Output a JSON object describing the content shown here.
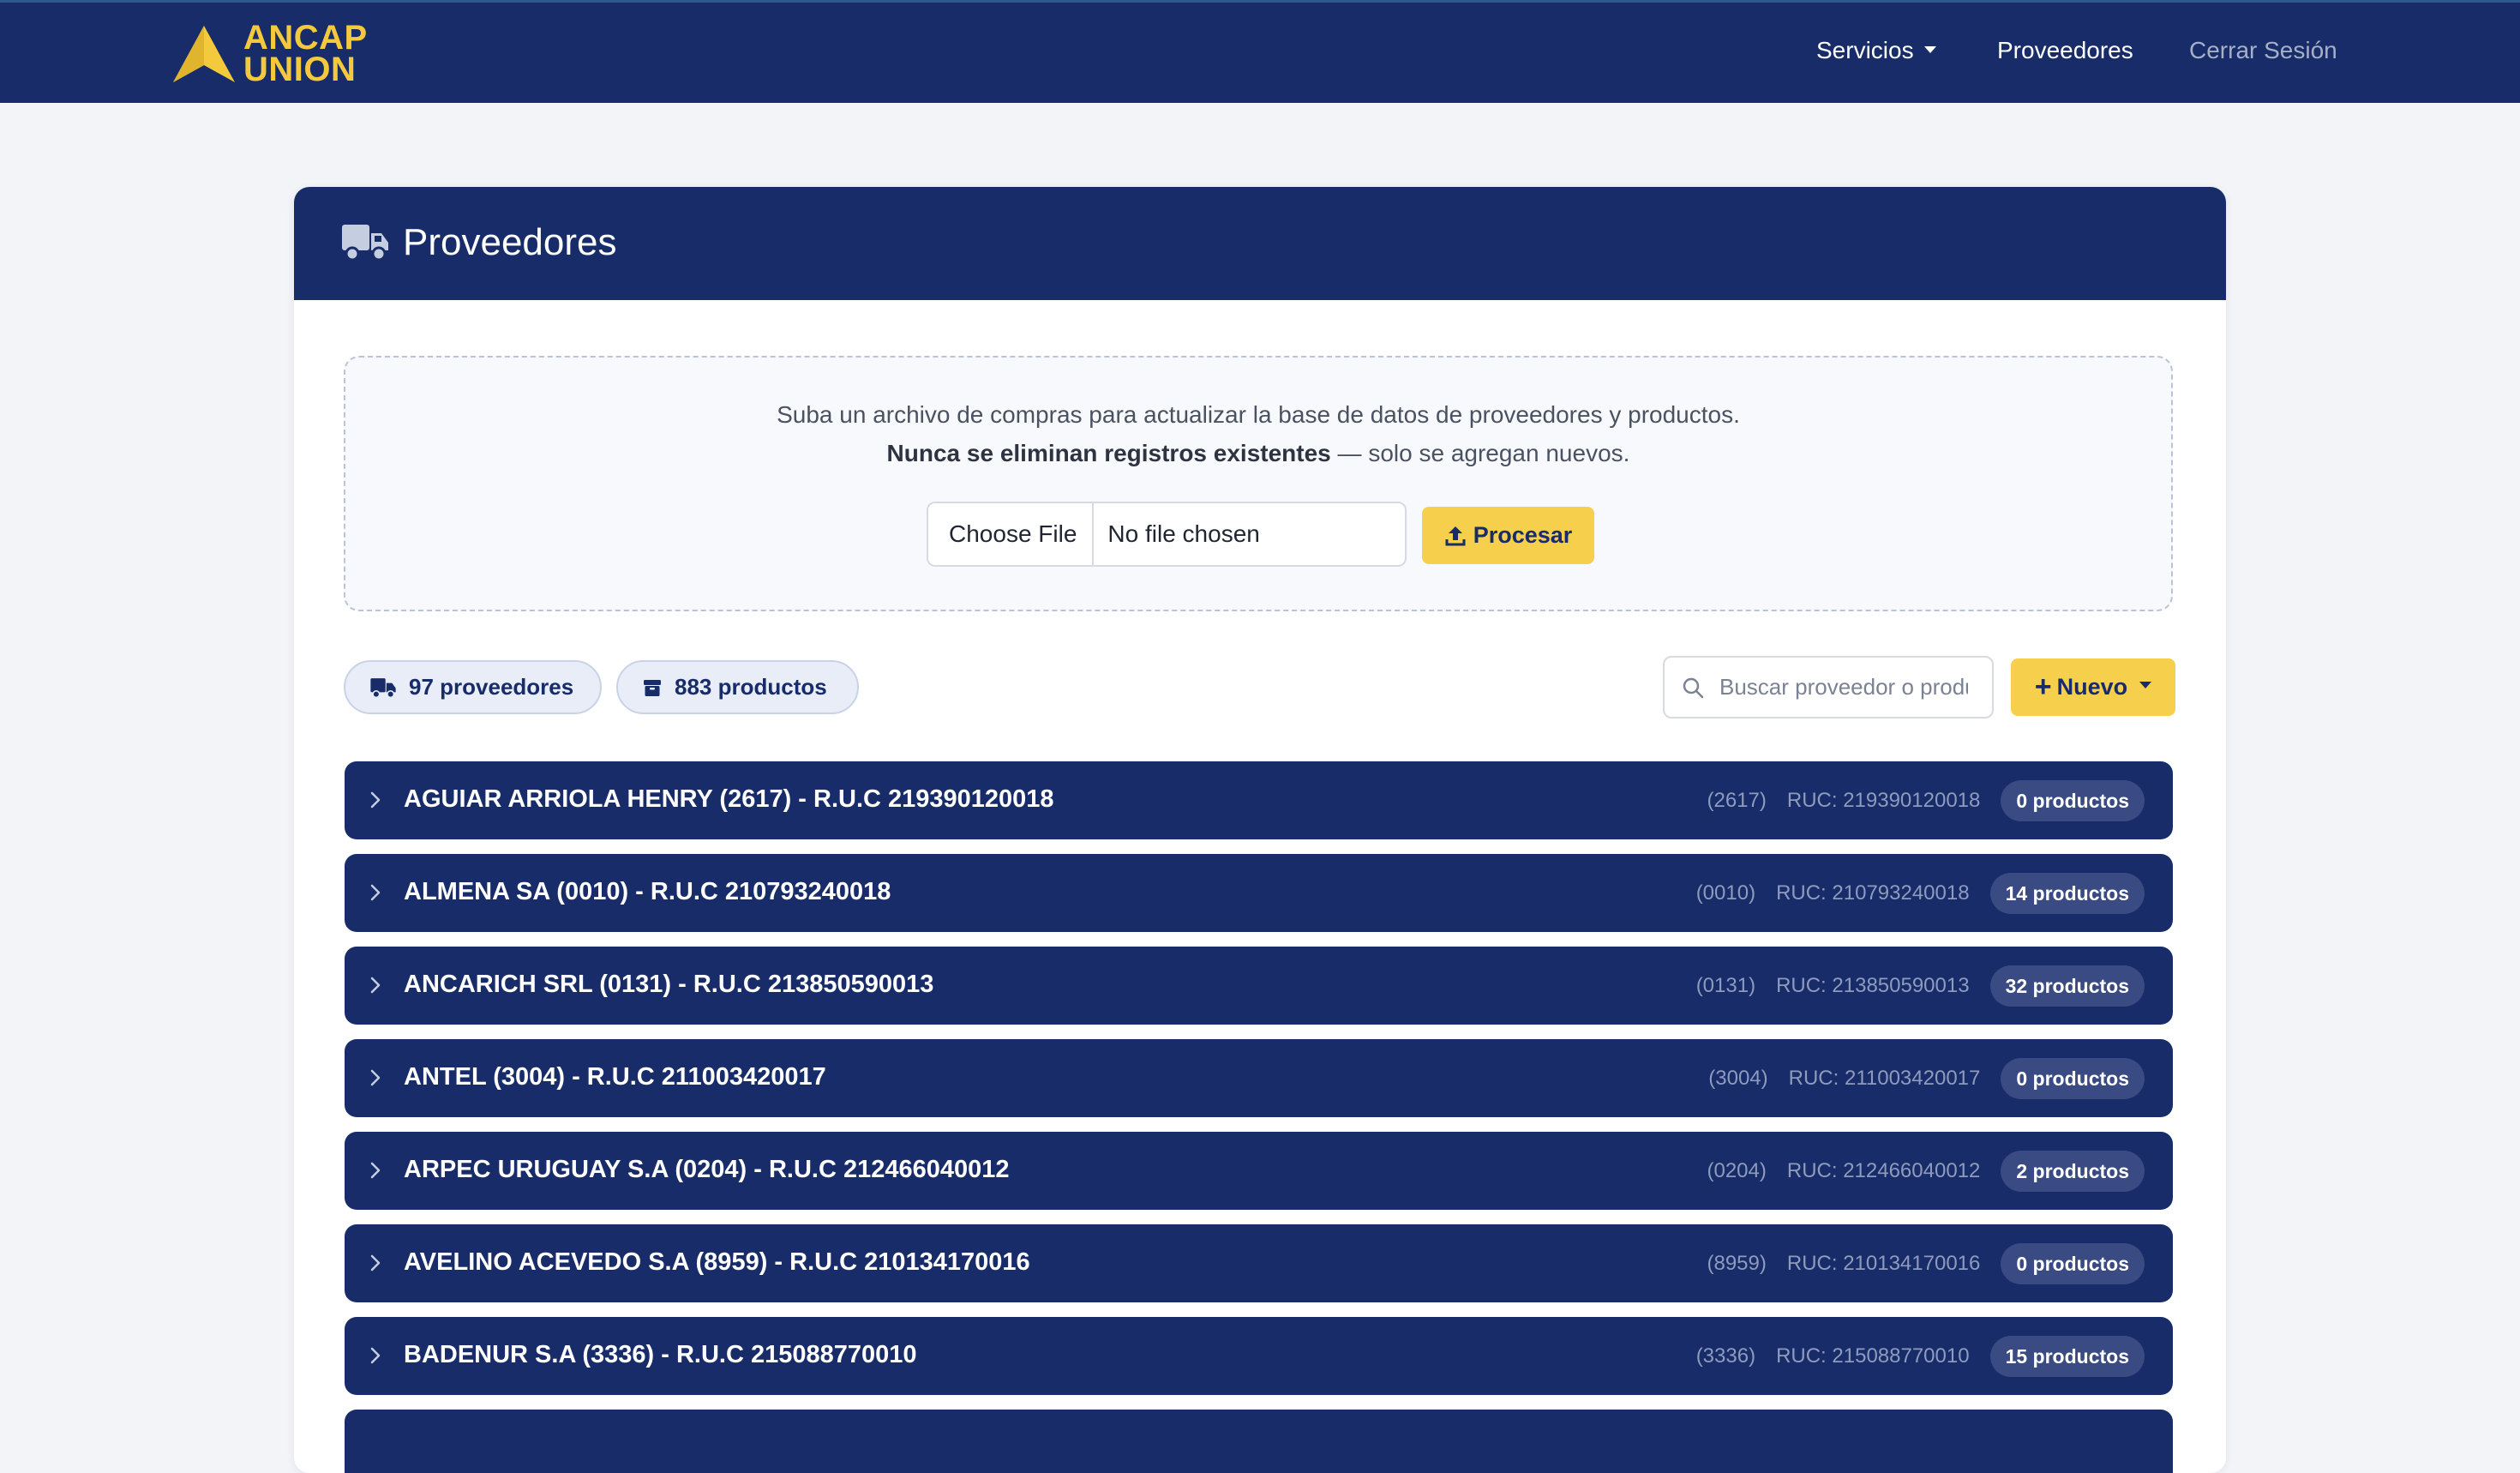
{
  "brand": {
    "line1": "ANCAP",
    "line2": "UNION"
  },
  "nav": {
    "servicios": "Servicios",
    "proveedores": "Proveedores",
    "logout": "Cerrar Sesión"
  },
  "card": {
    "title": "Proveedores"
  },
  "upload": {
    "line1": "Suba un archivo de compras para actualizar la base de datos de proveedores y productos.",
    "line2_bold": "Nunca se eliminan registros existentes",
    "line2_rest": " — solo se agregan nuevos.",
    "choose_label": "Choose File",
    "no_file": "No file chosen",
    "procesar_label": "Procesar"
  },
  "stats": {
    "proveedores": "97 proveedores",
    "productos": "883 productos"
  },
  "search": {
    "placeholder": "Buscar proveedor o producto..."
  },
  "nuevo": {
    "label": "Nuevo"
  },
  "suppliers": [
    {
      "name": "AGUIAR ARRIOLA HENRY (2617) - R.U.C 219390120018",
      "code": "(2617)",
      "ruc": "RUC: 219390120018",
      "badge": "0 productos"
    },
    {
      "name": "ALMENA SA (0010) - R.U.C 210793240018",
      "code": "(0010)",
      "ruc": "RUC: 210793240018",
      "badge": "14 productos"
    },
    {
      "name": "ANCARICH SRL (0131) - R.U.C 213850590013",
      "code": "(0131)",
      "ruc": "RUC: 213850590013",
      "badge": "32 productos"
    },
    {
      "name": "ANTEL (3004) - R.U.C 211003420017",
      "code": "(3004)",
      "ruc": "RUC: 211003420017",
      "badge": "0 productos"
    },
    {
      "name": "ARPEC URUGUAY S.A (0204) - R.U.C 212466040012",
      "code": "(0204)",
      "ruc": "RUC: 212466040012",
      "badge": "2 productos"
    },
    {
      "name": "AVELINO ACEVEDO S.A (8959) - R.U.C 210134170016",
      "code": "(8959)",
      "ruc": "RUC: 210134170016",
      "badge": "0 productos"
    },
    {
      "name": "BADENUR S.A (3336) - R.U.C 215088770010",
      "code": "(3336)",
      "ruc": "RUC: 215088770010",
      "badge": "15 productos"
    }
  ],
  "colors": {
    "navy": "#172c69",
    "accent_yellow": "#f6d04d",
    "brand_yellow": "#f4c93c",
    "background": "#f3f4f8"
  }
}
